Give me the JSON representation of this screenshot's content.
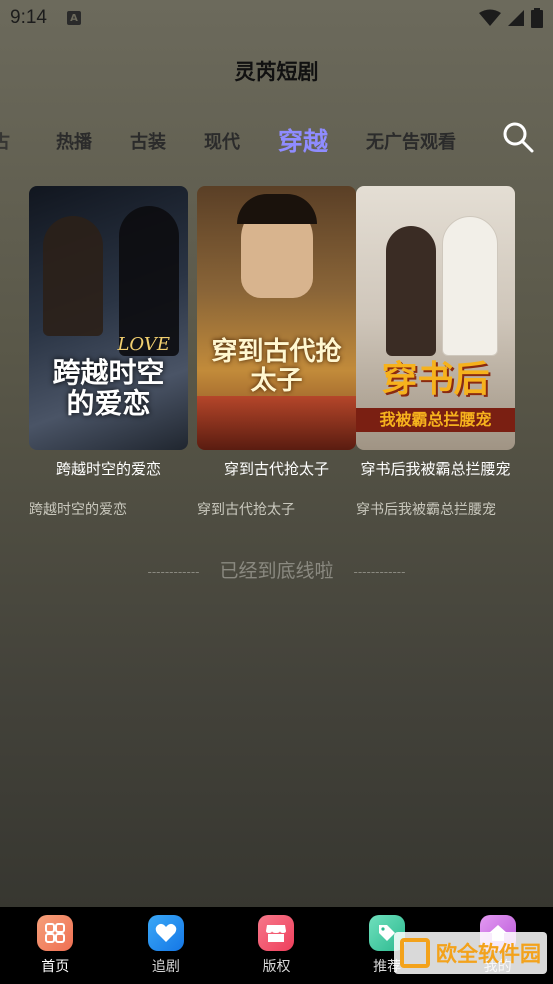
{
  "status_bar": {
    "time": "9:14",
    "notification_icon": "A"
  },
  "app": {
    "title": "灵芮短剧"
  },
  "tabs": [
    {
      "label": "古"
    },
    {
      "label": "热播"
    },
    {
      "label": "古装"
    },
    {
      "label": "现代"
    },
    {
      "label": "穿越",
      "active": true
    },
    {
      "label": "无广告观看"
    }
  ],
  "cards": [
    {
      "poster_text": "跨越时空的爱恋",
      "poster_tag": "LOVE",
      "title": "跨越时空的爱恋",
      "subtitle": "跨越时空的爱恋",
      "colors": [
        "#1b2230",
        "#3b4656"
      ]
    },
    {
      "poster_text": "穿到古代抢太子",
      "title": "穿到古代抢太子",
      "subtitle": "穿到古代抢太子",
      "colors": [
        "#6b4a2a",
        "#c9923e"
      ]
    },
    {
      "poster_text": "穿书后",
      "poster_sub": "我被霸总拦腰宠",
      "title": "穿书后我被霸总拦腰宠",
      "subtitle": "穿书后我被霸总拦腰宠",
      "colors": [
        "#d8d2c8",
        "#9a8e82"
      ]
    }
  ],
  "list_end": {
    "text": "已经到底线啦",
    "dash": "------------"
  },
  "bottom_nav": [
    {
      "label": "首页",
      "icon": "grid-icon",
      "color": "#f07a5a",
      "active": true
    },
    {
      "label": "追剧",
      "icon": "heart-icon",
      "color": "#1a8ef0"
    },
    {
      "label": "版权",
      "icon": "store-icon",
      "color": "#f0506a"
    },
    {
      "label": "推荐",
      "icon": "tag-icon",
      "color": "#3fc7a0"
    },
    {
      "label": "我的",
      "icon": "home-icon",
      "color": "#c968e0"
    }
  ],
  "watermark": {
    "text": "欧全软件园"
  }
}
